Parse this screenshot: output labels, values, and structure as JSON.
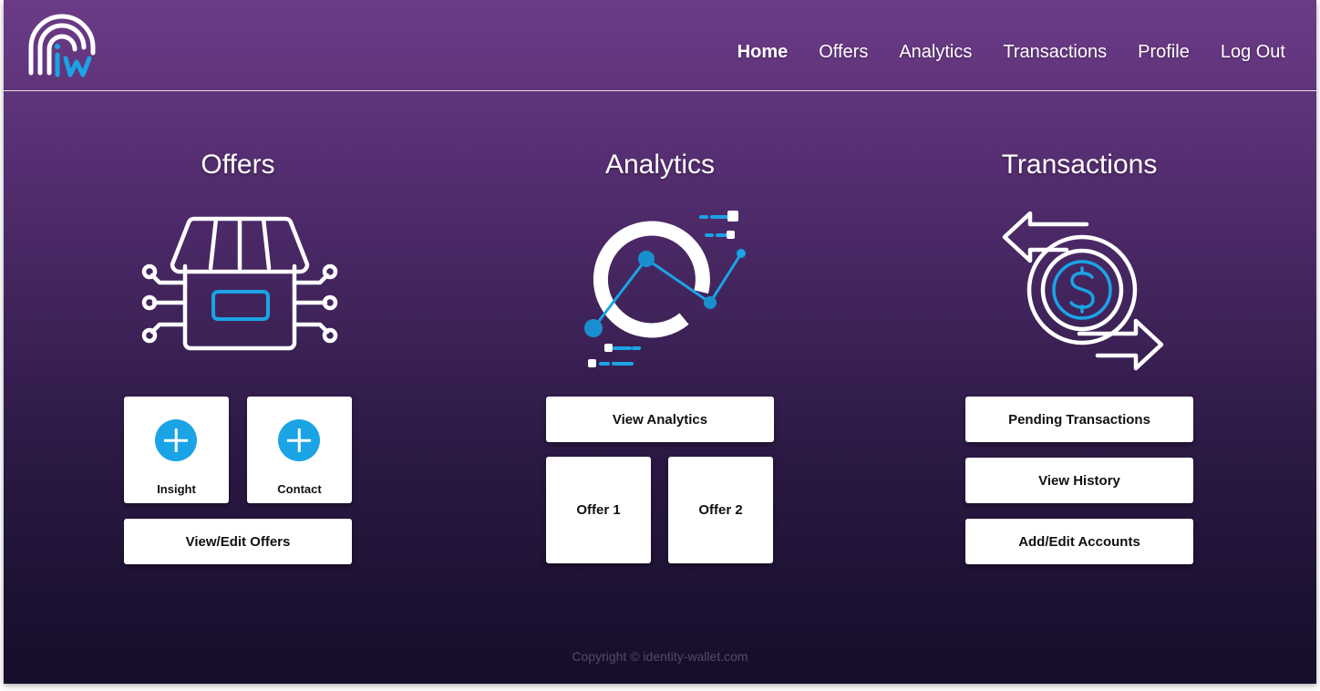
{
  "nav": {
    "items": [
      {
        "label": "Home",
        "active": true
      },
      {
        "label": "Offers"
      },
      {
        "label": "Analytics"
      },
      {
        "label": "Transactions"
      },
      {
        "label": "Profile"
      },
      {
        "label": "Log Out"
      }
    ]
  },
  "offers": {
    "title": "Offers",
    "insight_label": "Insight",
    "contact_label": "Contact",
    "view_edit_label": "View/Edit Offers"
  },
  "analytics": {
    "title": "Analytics",
    "view_label": "View Analytics",
    "offer1_label": "Offer 1",
    "offer2_label": "Offer 2"
  },
  "transactions": {
    "title": "Transactions",
    "pending_label": "Pending Transactions",
    "history_label": "View History",
    "accounts_label": "Add/Edit Accounts"
  },
  "footer": {
    "copyright": "Copyright © identity-wallet.com"
  },
  "colors": {
    "accent": "#1aa4e6",
    "bg_top": "#6c3b87",
    "bg_bottom": "#150d29"
  },
  "icons": {
    "logo": "fingerprint-iw-logo",
    "offers": "storefront-network-icon",
    "analytics": "donut-line-chart-icon",
    "transactions": "dollar-exchange-arrows-icon",
    "tile_add": "plus-circle-icon"
  }
}
